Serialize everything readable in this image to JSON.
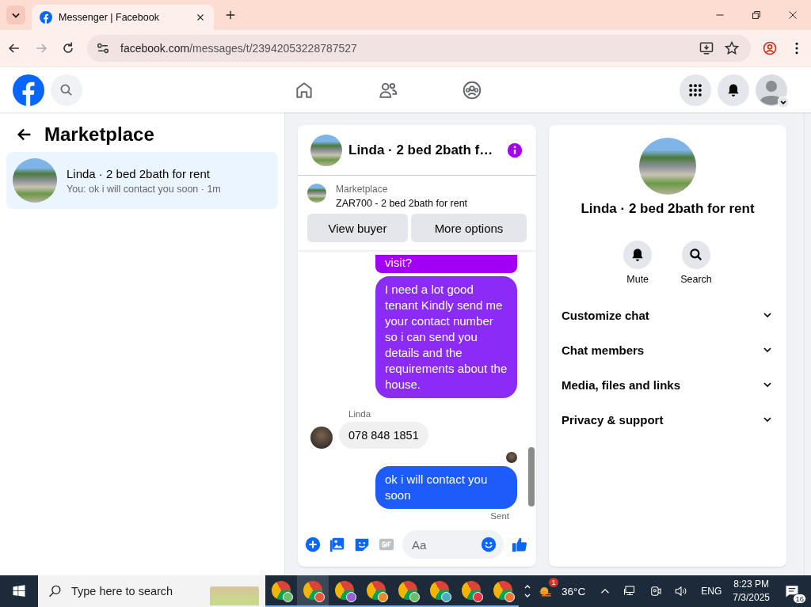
{
  "browser": {
    "tab_title": "Messenger | Facebook",
    "url_host": "facebook.com",
    "url_path": "/messages/t/23942053228787527"
  },
  "sidebar": {
    "title": "Marketplace",
    "conversations": [
      {
        "title": "Linda · 2 bed 2bath for rent",
        "preview": "You: ok i will contact you soon · 1m",
        "selected": true
      }
    ]
  },
  "chat": {
    "title": "Linda · 2 bed 2bath f…",
    "listing": {
      "label": "Marketplace",
      "name": "ZAR700 - 2 bed 2bath for rent"
    },
    "buttons": [
      "View buyer",
      "More options"
    ],
    "messages": [
      {
        "kind": "outgoing",
        "color": "#a100f2",
        "text": "visit?"
      },
      {
        "kind": "outgoing",
        "color": "#8a2cf6",
        "text": "I need a lot good tenant Kindly send me your contact number so i can send you details and the requirements about the house."
      },
      {
        "kind": "incoming",
        "sender": "Linda",
        "text": "078 848 1851"
      },
      {
        "kind": "read_receipt"
      },
      {
        "kind": "outgoing",
        "color": "#1d5cfb",
        "text": "ok i will contact you soon"
      }
    ],
    "status": "Sent",
    "composer": {
      "placeholder": "Aa"
    }
  },
  "details": {
    "title": "Linda · 2 bed 2bath for rent",
    "actions": [
      {
        "kind": "mute",
        "label": "Mute"
      },
      {
        "kind": "search",
        "label": "Search"
      }
    ],
    "sections": [
      {
        "label": "Customize chat",
        "expanded": false
      },
      {
        "label": "Chat members",
        "expanded": false
      },
      {
        "label": "Media, files and links",
        "expanded": false
      },
      {
        "label": "Privacy & support",
        "expanded": false
      }
    ]
  },
  "taskbar": {
    "search_placeholder": "Type here to search",
    "apps": [
      {
        "color": "#6dbb6d",
        "selected": false
      },
      {
        "color": "#e8553a",
        "selected": true
      },
      {
        "color": "#9a5fd6",
        "selected": false
      },
      {
        "color": "#e88a2a",
        "selected": false
      },
      {
        "color": "#6dbb6d",
        "selected": false
      },
      {
        "color": "#4aaec2",
        "selected": false
      },
      {
        "color": "#e8354a",
        "selected": false
      },
      {
        "color": "#e8763a",
        "selected": false
      }
    ],
    "weather_badge": "1",
    "temperature": "36°C",
    "language": "ENG",
    "time": "8:23 PM",
    "date": "7/3/2025",
    "notification_count": "16"
  }
}
